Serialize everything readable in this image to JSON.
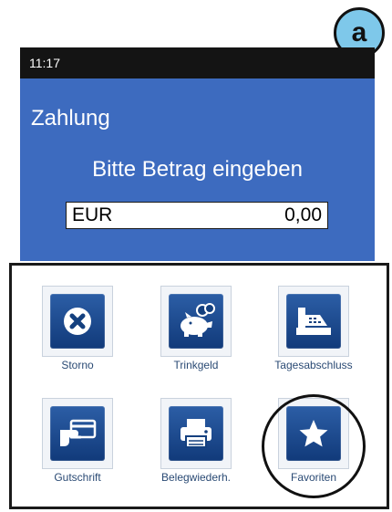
{
  "badge": {
    "label": "a"
  },
  "status": {
    "time": "11:17"
  },
  "payment": {
    "title": "Zahlung",
    "prompt": "Bitte Betrag eingeben",
    "currency": "EUR",
    "amount": "0,00"
  },
  "menu": {
    "items": [
      {
        "label": "Storno",
        "icon": "cancel-x-icon"
      },
      {
        "label": "Trinkgeld",
        "icon": "piggy-bank-icon"
      },
      {
        "label": "Tagesabschluss",
        "icon": "cash-register-icon"
      },
      {
        "label": "Gutschrift",
        "icon": "card-payment-icon"
      },
      {
        "label": "Belegwiederh.",
        "icon": "printer-icon"
      },
      {
        "label": "Favoriten",
        "icon": "star-icon"
      }
    ]
  },
  "colors": {
    "header_bg": "#3d6bbf",
    "status_bg": "#141414",
    "tile_icon": "#1a4a8f",
    "badge_bg": "#7ec8ea",
    "label_text": "#2a4a74"
  }
}
